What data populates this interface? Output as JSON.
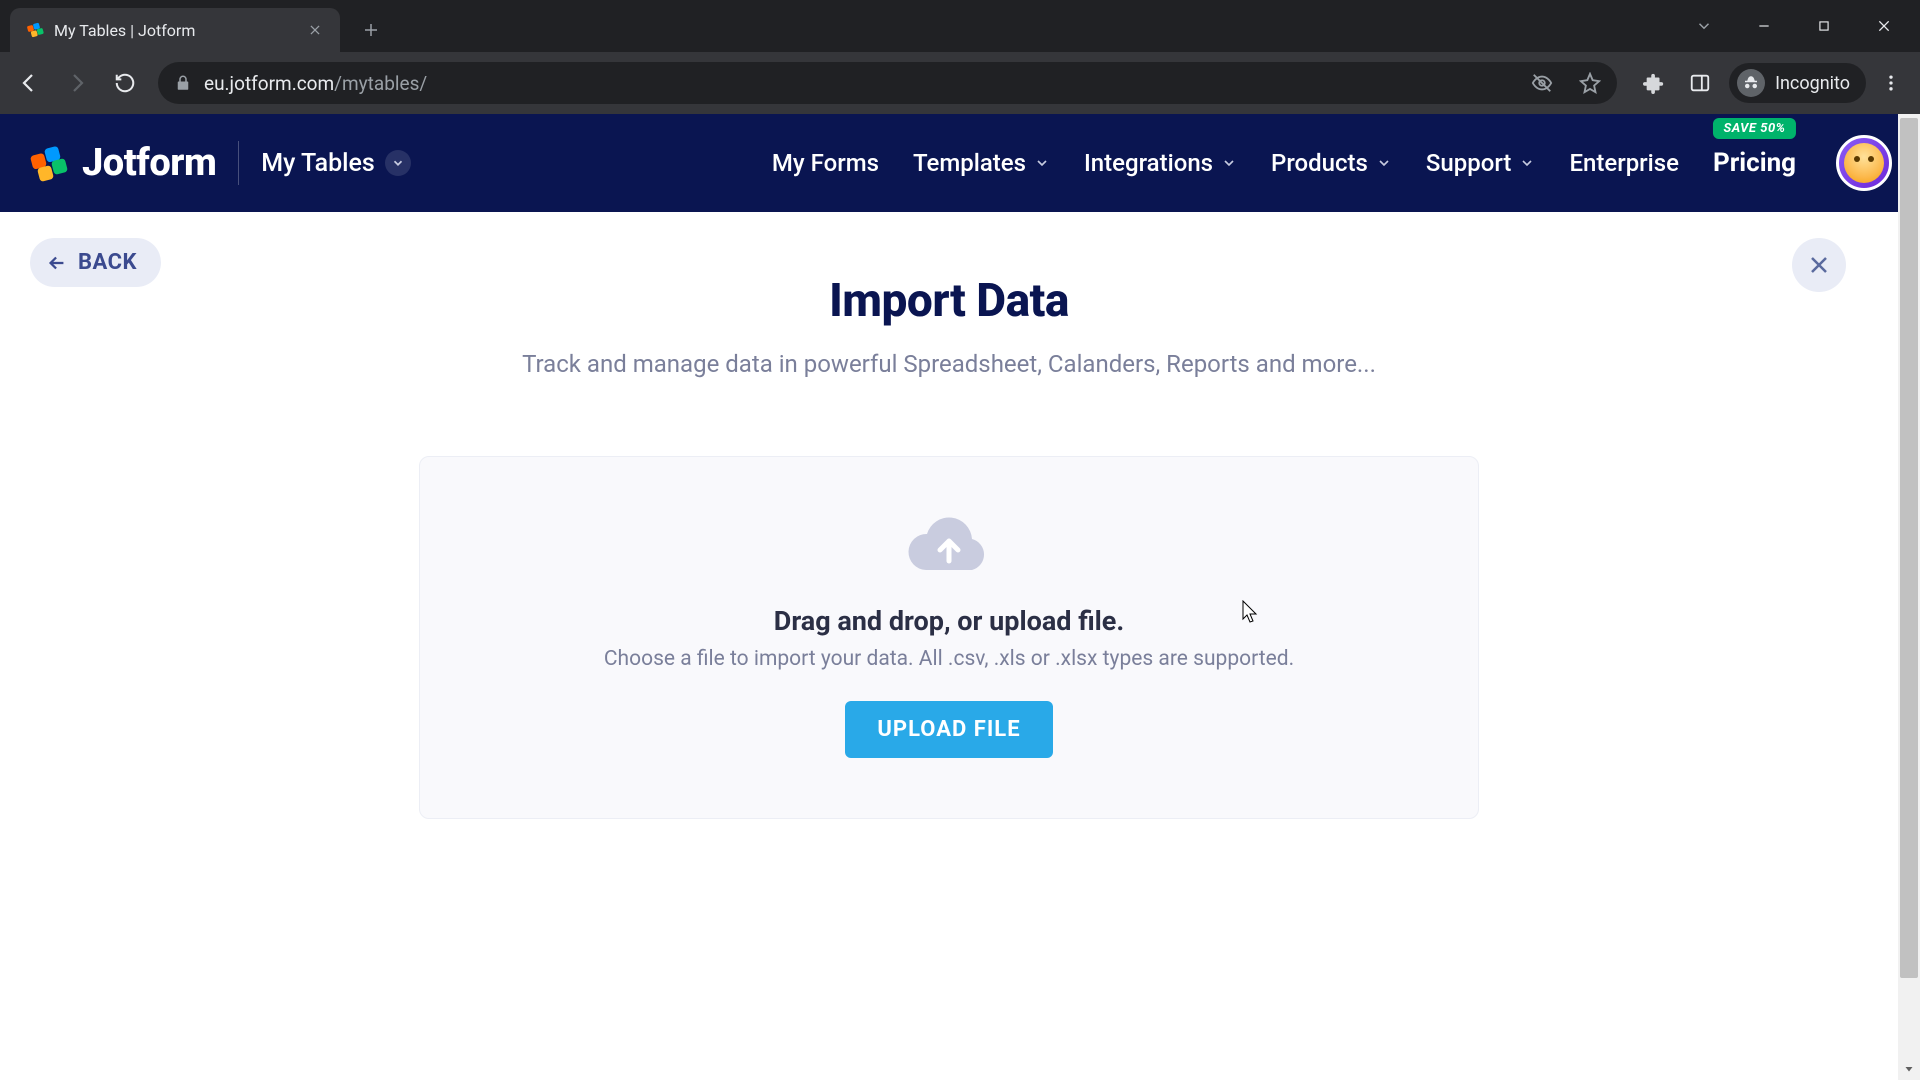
{
  "browser": {
    "tab_title": "My Tables | Jotform",
    "url_domain": "eu.jotform.com",
    "url_path": "/mytables/",
    "incognito_label": "Incognito"
  },
  "header": {
    "brand": "Jotform",
    "section_label": "My Tables",
    "nav": {
      "my_forms": "My Forms",
      "templates": "Templates",
      "integrations": "Integrations",
      "products": "Products",
      "support": "Support",
      "enterprise": "Enterprise",
      "pricing": "Pricing",
      "save_badge": "SAVE 50%"
    }
  },
  "page": {
    "back_label": "BACK",
    "title": "Import Data",
    "subtitle": "Track and manage data in powerful Spreadsheet, Calanders, Reports and more...",
    "drop_title": "Drag and drop, or upload file.",
    "drop_sub": "Choose a file to import your data. All .csv, .xls or .xlsx types are supported.",
    "upload_button": "UPLOAD FILE"
  }
}
